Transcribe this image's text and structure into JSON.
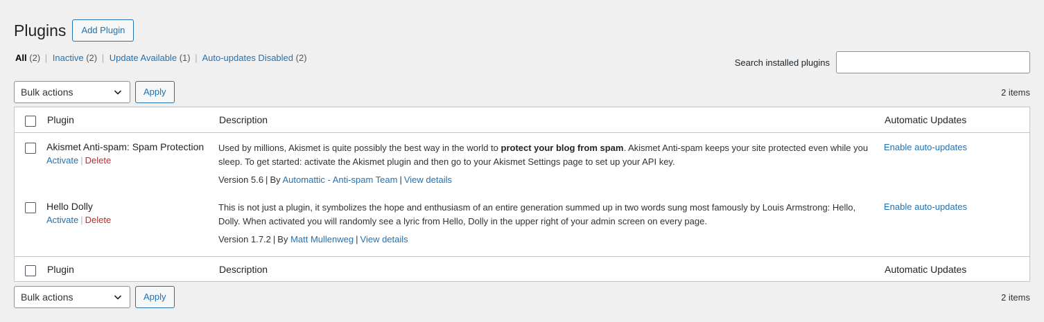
{
  "header": {
    "title": "Plugins",
    "add_button": "Add Plugin"
  },
  "filters": [
    {
      "label": "All",
      "count": "(2)",
      "current": true
    },
    {
      "label": "Inactive",
      "count": "(2)"
    },
    {
      "label": "Update Available",
      "count": "(1)"
    },
    {
      "label": "Auto-updates Disabled",
      "count": "(2)"
    }
  ],
  "search": {
    "label": "Search installed plugins",
    "value": ""
  },
  "tablenav": {
    "bulk_actions": "Bulk actions",
    "apply": "Apply",
    "items": "2 items"
  },
  "columns": {
    "plugin": "Plugin",
    "description": "Description",
    "auto_updates": "Automatic Updates"
  },
  "plugins": [
    {
      "name": "Akismet Anti-spam: Spam Protection",
      "activate": "Activate",
      "delete": "Delete",
      "desc_before": "Used by millions, Akismet is quite possibly the best way in the world to ",
      "desc_bold": "protect your blog from spam",
      "desc_after": ". Akismet Anti-spam keeps your site protected even while you sleep. To get started: activate the Akismet plugin and then go to your Akismet Settings page to set up your API key.",
      "version": "Version 5.6",
      "by": "By",
      "author": "Automattic - Anti-spam Team",
      "view_details": "View details",
      "auto_update": "Enable auto-updates"
    },
    {
      "name": "Hello Dolly",
      "activate": "Activate",
      "delete": "Delete",
      "desc": "This is not just a plugin, it symbolizes the hope and enthusiasm of an entire generation summed up in two words sung most famously by Louis Armstrong: Hello, Dolly. When activated you will randomly see a lyric from Hello, Dolly in the upper right of your admin screen on every page.",
      "version": "Version 1.7.2",
      "by": "By",
      "author": "Matt Mullenweg",
      "view_details": "View details",
      "auto_update": "Enable auto-updates"
    }
  ]
}
